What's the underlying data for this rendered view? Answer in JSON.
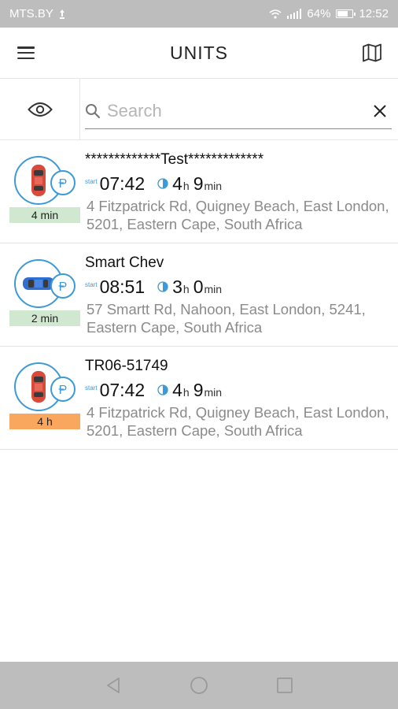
{
  "status_bar": {
    "carrier": "MTS.BY",
    "battery": "64%",
    "time": "12:52"
  },
  "header": {
    "title": "UNITS",
    "menu_icon": "hamburger-menu-icon",
    "map_icon": "map-icon"
  },
  "search": {
    "placeholder": "Search",
    "value": "",
    "eye_icon": "eye-icon",
    "search_icon": "search-icon",
    "clear_icon": "close-icon"
  },
  "units": [
    {
      "name": "*************Test*************",
      "vehicle_icon": "red-car-icon",
      "vehicle_color": "#d94a3a",
      "status_icon": "parking-icon",
      "last_update": "4 min",
      "badge_color": "#cfe8cf",
      "start_label": "start",
      "start_time": "07:42",
      "duration_hours": "4",
      "duration_hours_unit": "h",
      "duration_minutes": "9",
      "duration_minutes_unit": "min",
      "address": "4 Fitzpatrick Rd, Quigney Beach, East London, 5201, Eastern Cape, South Africa"
    },
    {
      "name": "Smart Chev",
      "vehicle_icon": "blue-car-icon",
      "vehicle_color": "#2f6fd1",
      "status_icon": "parking-icon",
      "last_update": "2 min",
      "badge_color": "#cfe8cf",
      "start_label": "start",
      "start_time": "08:51",
      "duration_hours": "3",
      "duration_hours_unit": "h",
      "duration_minutes": "0",
      "duration_minutes_unit": "min",
      "address": "57 Smartt Rd, Nahoon, East London, 5241, Eastern Cape, South Africa"
    },
    {
      "name": "TR06-51749",
      "vehicle_icon": "red-car-icon",
      "vehicle_color": "#d94a3a",
      "status_icon": "parking-icon",
      "last_update": "4 h",
      "badge_color": "#f9a65f",
      "start_label": "start",
      "start_time": "07:42",
      "duration_hours": "4",
      "duration_hours_unit": "h",
      "duration_minutes": "9",
      "duration_minutes_unit": "min",
      "address": "4 Fitzpatrick Rd, Quigney Beach, East London, 5201, Eastern Cape, South Africa"
    }
  ],
  "nav_bar": {
    "back_icon": "back-triangle-icon",
    "home_icon": "home-circle-icon",
    "recents_icon": "recents-square-icon"
  },
  "colors": {
    "accent": "#3d9ad8",
    "status_bar": "#bdbdbd",
    "address_text": "#8b8b8b"
  }
}
